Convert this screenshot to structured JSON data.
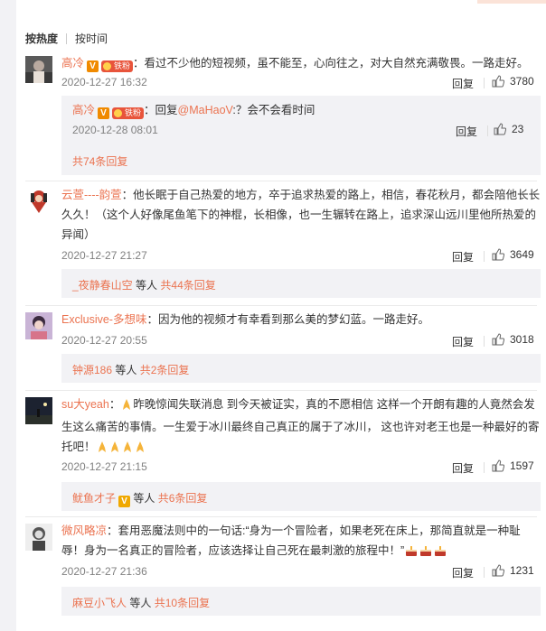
{
  "sort": {
    "hot": "按热度",
    "time": "按时间"
  },
  "ui": {
    "reply": "回复",
    "colon": "：",
    "etc": "等人",
    "fan_badge": "铁粉"
  },
  "comments": [
    {
      "user": "高冷",
      "text": "看过不少他的短视频，虽不能至，心向往之，对大自然充满敬畏。一路走好。",
      "time": "2020-12-27 16:32",
      "likes": "3780",
      "sub": {
        "user": "高冷",
        "prefix": "：回复",
        "mention": "@MaHaoV",
        "text": ":？会不会看时间",
        "time": "2020-12-28 08:01",
        "likes": "23",
        "more": "共74条回复"
      }
    },
    {
      "user": "云萱----韵萱",
      "text": "他长眠于自己热爱的地方，卒于追求热爱的路上，相信，春花秋月，都会陪他长长久久！（这个人好像尾鱼笔下的神棍，长相像，也一生辗转在路上，追求深山远川里他所热爱的异闻）",
      "time": "2020-12-27 21:27",
      "likes": "3649",
      "reply_users": "_夜静春山空",
      "more": "共44条回复"
    },
    {
      "user": "Exclusive-多想味",
      "text": "因为他的视频才有幸看到那么美的梦幻蓝。一路走好。",
      "time": "2020-12-27 20:55",
      "likes": "3018",
      "reply_users": "钟源186",
      "more": "共2条回复"
    },
    {
      "user": "su大yeah",
      "text": "昨晚惊闻失联消息 到今天被证实，真的不愿相信 这样一个开朗有趣的人竟然会发生这么痛苦的事情。一生爱于冰川最终自己真正的属于了冰川，  这也许对老王也是一种最好的寄托吧！",
      "time": "2020-12-27 21:15",
      "likes": "1597",
      "reply_users": "鱿鱼才子",
      "more": "共6条回复"
    },
    {
      "user": "微风略凉",
      "text": "套用恶魔法则中的一句话:“身为一个冒险者，如果老死在床上，那简直就是一种耻辱！身为一名真正的冒险者，应该选择让自己死在最刺激的旅程中！”",
      "time": "2020-12-27 21:36",
      "likes": "1231",
      "reply_users": "麻豆小飞人",
      "more": "共10条回复"
    }
  ],
  "colors": {
    "accent": "#eb7350",
    "meta": "#808080",
    "subbg": "#f2f2f5"
  }
}
